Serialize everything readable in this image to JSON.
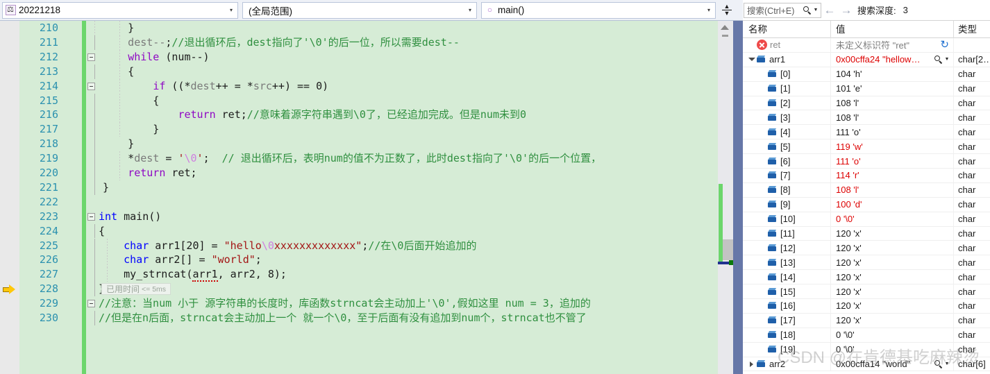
{
  "toolbar": {
    "project_combo": "20221218",
    "project_icon": "project-icon",
    "scope_combo": "(全局范围)",
    "function_combo": "main()",
    "function_icon": "function-icon",
    "split_icon": "split-view-icon",
    "dropdown_arrow": "▾"
  },
  "editor": {
    "lines": [
      {
        "num": "210",
        "text": "            }"
      },
      {
        "num": "211",
        "text": "            dest--;//退出循环后，dest指向了'\\0'的后一位，所以需要dest--"
      },
      {
        "num": "212",
        "text": "            while (num--)"
      },
      {
        "num": "213",
        "text": "            {"
      },
      {
        "num": "214",
        "text": "                if ((*dest++ = *src++) == 0)"
      },
      {
        "num": "215",
        "text": "                {"
      },
      {
        "num": "216",
        "text": "                    return ret;//意味着源字符串遇到\\0了，已经追加完成。但是num未到0"
      },
      {
        "num": "217",
        "text": "                }"
      },
      {
        "num": "218",
        "text": "            }"
      },
      {
        "num": "219",
        "text": "            *dest = '\\0';  // 退出循环后，表明num的值不为正数了，此时dest指向了'\\0'的后一个位置，"
      },
      {
        "num": "220",
        "text": "            return ret;"
      },
      {
        "num": "221",
        "text": "        }"
      },
      {
        "num": "222",
        "text": ""
      },
      {
        "num": "223",
        "text": "int main()"
      },
      {
        "num": "224",
        "text": "{"
      },
      {
        "num": "225",
        "text": "    char arr1[20] = \"hello\\0xxxxxxxxxxxxx\";//在\\0后面开始追加的"
      },
      {
        "num": "226",
        "text": "    char arr2[] = \"world\";"
      },
      {
        "num": "227",
        "text": "    my_strncat(arr1, arr2, 8);"
      },
      {
        "num": "228",
        "text": "}"
      },
      {
        "num": "229",
        "text": "//注意：当num 小于 源字符串的长度时，库函数strncat会主动加上'\\0',假如这里 num = 3，追加的"
      },
      {
        "num": "230",
        "text": "//但是在n后面，strncat会主动加上一个 就一个\\0，至于后面有没有追加到num个，strncat也不管了"
      }
    ],
    "elapsed_label": "已用时间",
    "elapsed_value": "<= 5ms",
    "current_line_marker": "current-statement-arrow"
  },
  "watch": {
    "search_placeholder": "搜索(Ctrl+E)",
    "search_icon": "search-icon",
    "back_arrow": "←",
    "forward_arrow": "→",
    "depth_label": "搜索深度:",
    "depth_value": "3",
    "columns": {
      "name": "名称",
      "value": "值",
      "type": "类型"
    },
    "rows": [
      {
        "indent": 0,
        "expander": "none",
        "icon": "error-icon",
        "name": "ret",
        "value": "未定义标识符 \"ret\"",
        "state": "err",
        "type": "",
        "refresh": true
      },
      {
        "indent": 0,
        "expander": "down",
        "icon": "cube-icon",
        "name": "arr1",
        "value": "0x00cffa24 \"hellow…",
        "state": "changed",
        "type": "char[2…",
        "magnifier": true
      },
      {
        "indent": 1,
        "expander": "none",
        "icon": "cube-icon",
        "name": "[0]",
        "value": "104 'h'",
        "state": "normal",
        "type": "char"
      },
      {
        "indent": 1,
        "expander": "none",
        "icon": "cube-icon",
        "name": "[1]",
        "value": "101 'e'",
        "state": "normal",
        "type": "char"
      },
      {
        "indent": 1,
        "expander": "none",
        "icon": "cube-icon",
        "name": "[2]",
        "value": "108 'l'",
        "state": "normal",
        "type": "char"
      },
      {
        "indent": 1,
        "expander": "none",
        "icon": "cube-icon",
        "name": "[3]",
        "value": "108 'l'",
        "state": "normal",
        "type": "char"
      },
      {
        "indent": 1,
        "expander": "none",
        "icon": "cube-icon",
        "name": "[4]",
        "value": "111 'o'",
        "state": "normal",
        "type": "char"
      },
      {
        "indent": 1,
        "expander": "none",
        "icon": "cube-icon",
        "name": "[5]",
        "value": "119 'w'",
        "state": "changed",
        "type": "char"
      },
      {
        "indent": 1,
        "expander": "none",
        "icon": "cube-icon",
        "name": "[6]",
        "value": "111 'o'",
        "state": "changed",
        "type": "char"
      },
      {
        "indent": 1,
        "expander": "none",
        "icon": "cube-icon",
        "name": "[7]",
        "value": "114 'r'",
        "state": "changed",
        "type": "char"
      },
      {
        "indent": 1,
        "expander": "none",
        "icon": "cube-icon",
        "name": "[8]",
        "value": "108 'l'",
        "state": "changed",
        "type": "char"
      },
      {
        "indent": 1,
        "expander": "none",
        "icon": "cube-icon",
        "name": "[9]",
        "value": "100 'd'",
        "state": "changed",
        "type": "char"
      },
      {
        "indent": 1,
        "expander": "none",
        "icon": "cube-icon",
        "name": "[10]",
        "value": "0 '\\0'",
        "state": "changed",
        "type": "char"
      },
      {
        "indent": 1,
        "expander": "none",
        "icon": "cube-icon",
        "name": "[11]",
        "value": "120 'x'",
        "state": "normal",
        "type": "char"
      },
      {
        "indent": 1,
        "expander": "none",
        "icon": "cube-icon",
        "name": "[12]",
        "value": "120 'x'",
        "state": "normal",
        "type": "char"
      },
      {
        "indent": 1,
        "expander": "none",
        "icon": "cube-icon",
        "name": "[13]",
        "value": "120 'x'",
        "state": "normal",
        "type": "char"
      },
      {
        "indent": 1,
        "expander": "none",
        "icon": "cube-icon",
        "name": "[14]",
        "value": "120 'x'",
        "state": "normal",
        "type": "char"
      },
      {
        "indent": 1,
        "expander": "none",
        "icon": "cube-icon",
        "name": "[15]",
        "value": "120 'x'",
        "state": "normal",
        "type": "char"
      },
      {
        "indent": 1,
        "expander": "none",
        "icon": "cube-icon",
        "name": "[16]",
        "value": "120 'x'",
        "state": "normal",
        "type": "char"
      },
      {
        "indent": 1,
        "expander": "none",
        "icon": "cube-icon",
        "name": "[17]",
        "value": "120 'x'",
        "state": "normal",
        "type": "char"
      },
      {
        "indent": 1,
        "expander": "none",
        "icon": "cube-icon",
        "name": "[18]",
        "value": "0 '\\0'",
        "state": "normal",
        "type": "char"
      },
      {
        "indent": 1,
        "expander": "none",
        "icon": "cube-icon",
        "name": "[19]",
        "value": "0 '\\0'",
        "state": "normal",
        "type": "char"
      },
      {
        "indent": 0,
        "expander": "right",
        "icon": "cube-icon",
        "name": "arr2",
        "value": "0x00cffa14 \"world\"",
        "state": "normal",
        "type": "char[6]",
        "magnifier": true
      }
    ]
  },
  "watermark": "CSDN @在肯德基吃麻辣烫",
  "colors": {
    "editor_changed_bg": "#d6ecd6",
    "change_bar": "#6cd66c",
    "keyword": "#0000ff",
    "comment": "#2f8f3f",
    "string": "#a31515",
    "linenum": "#2b91af",
    "changed_value": "#dd0000"
  }
}
